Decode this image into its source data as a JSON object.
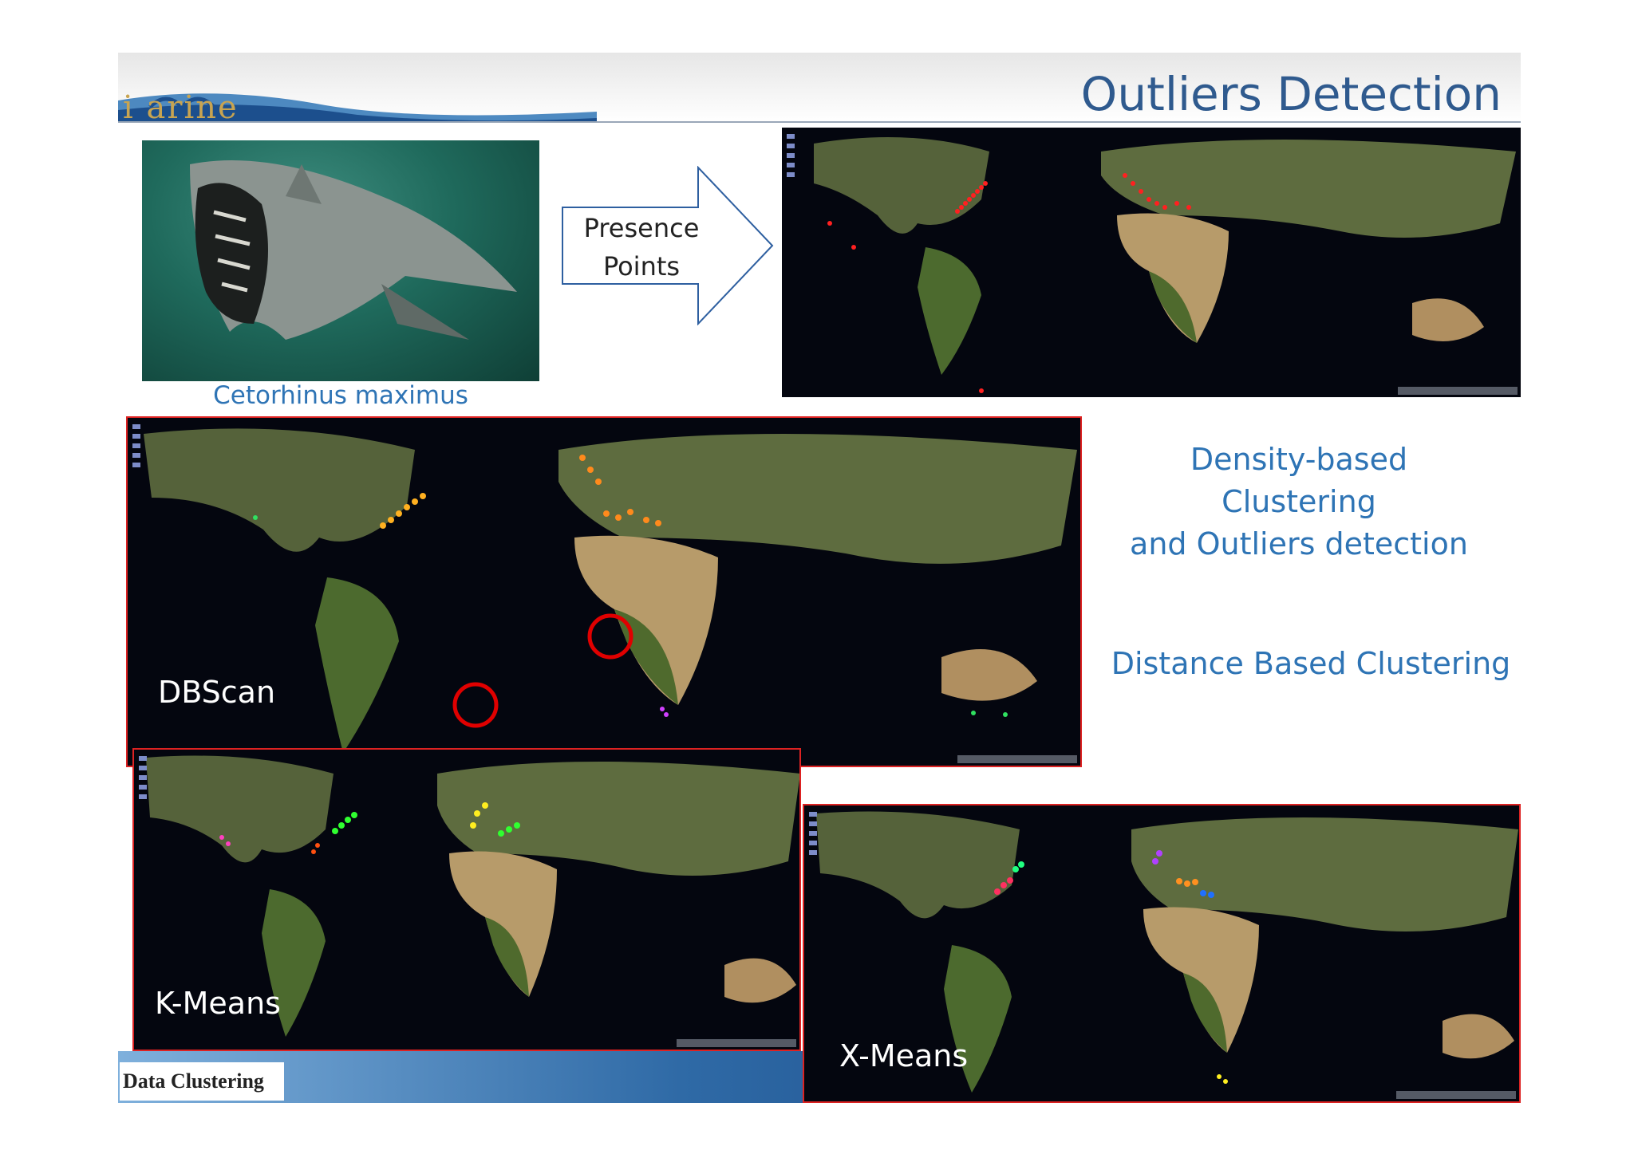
{
  "header": {
    "logo_text": "i arine",
    "title": "Outliers Detection"
  },
  "species": {
    "caption": "Cetorhinus maximus"
  },
  "arrow": {
    "line1": "Presence",
    "line2": "Points"
  },
  "maps": {
    "dbscan": "DBScan",
    "kmeans": "K-Means",
    "xmeans": "X-Means"
  },
  "side": {
    "density_line1": "Density-based",
    "density_line2": "Clustering",
    "density_line3": "and Outliers detection",
    "distance": "Distance Based Clustering"
  },
  "footer": {
    "label": "Data Clustering"
  },
  "colors": {
    "title": "#2f5a8e",
    "accent_text": "#2e74b5",
    "map_border": "#dd2222",
    "ocean": "#04060f"
  },
  "icons": [
    "pan-zoom-control-icon",
    "outlier-circle-icon"
  ]
}
